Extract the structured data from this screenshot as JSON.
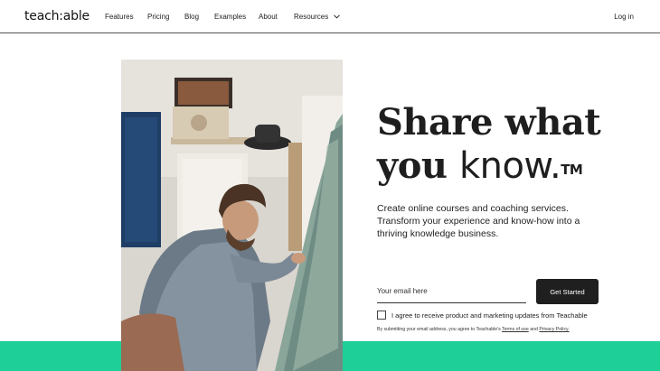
{
  "brand": {
    "logo": "teach:able"
  },
  "nav": {
    "items": [
      "Features",
      "Pricing",
      "Blog",
      "Examples",
      "About",
      "Resources"
    ],
    "login": "Log in"
  },
  "hero": {
    "title_line1": "Share what",
    "title_line2_pre": "you ",
    "title_line2_bold": "know.",
    "title_tm": "TM",
    "subtitle": "Create online courses and coaching services. Transform your experience and know-how into a thriving knowledge business."
  },
  "form": {
    "email_placeholder": "Your email here",
    "cta": "Get Started",
    "consent": "I agree to receive product and marketing updates from Teachable",
    "legal_pre": "By submitting your email address, you agree to Teachable's",
    "legal_terms": "Terms of use",
    "legal_and": "and",
    "legal_privacy": "Privacy Policy."
  },
  "colors": {
    "accent_band": "#1ecf97",
    "cta_bg": "#1f1f1f"
  }
}
